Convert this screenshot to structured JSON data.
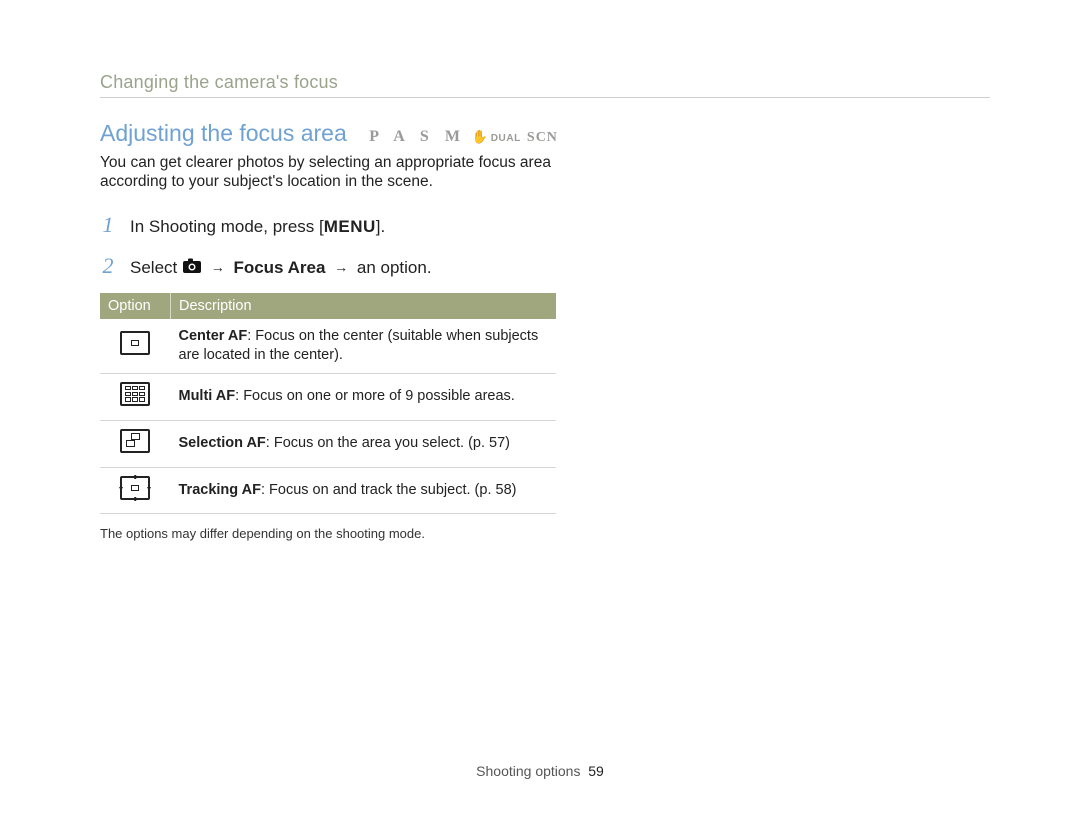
{
  "header": {
    "breadcrumb": "Changing the camera's focus"
  },
  "section": {
    "title": "Adjusting the focus area",
    "modes": {
      "letters": "P A S M",
      "dual": "DUAL",
      "scn": "SCN"
    },
    "intro": "You can get clearer photos by selecting an appropriate focus area according to your subject's location in the scene."
  },
  "steps": [
    {
      "num": "1",
      "prefix": "In Shooting mode, press [",
      "key": "MENU",
      "suffix": "]."
    },
    {
      "num": "2",
      "select": "Select ",
      "focus_area": "Focus Area",
      "tail": " an option."
    }
  ],
  "table": {
    "head_option": "Option",
    "head_desc": "Description",
    "rows": [
      {
        "name": "Center AF",
        "desc": ": Focus on the center (suitable when subjects are located in the center)."
      },
      {
        "name": "Multi AF",
        "desc": ": Focus on one or more of 9 possible areas."
      },
      {
        "name": "Selection AF",
        "desc": ": Focus on the area you select. (p. 57)"
      },
      {
        "name": "Tracking AF",
        "desc": ": Focus on and track the subject. (p. 58)"
      }
    ]
  },
  "footnote": "The options may differ depending on the shooting mode.",
  "footer": {
    "section": "Shooting options",
    "page": "59"
  }
}
